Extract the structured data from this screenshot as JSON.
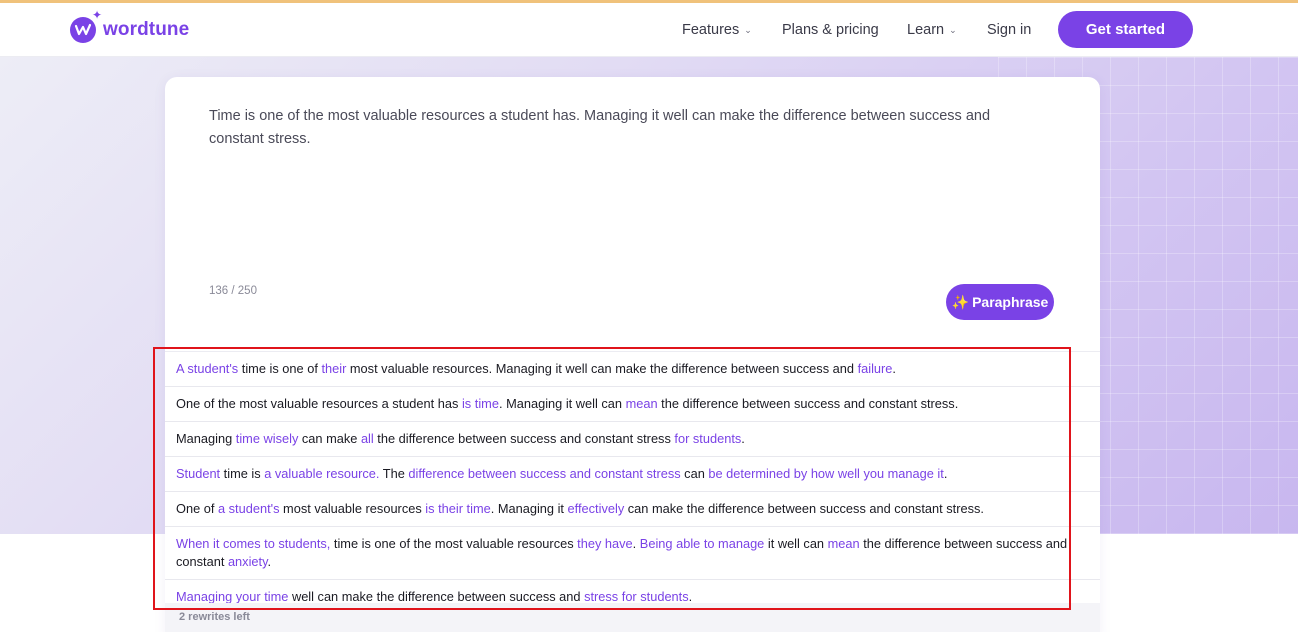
{
  "brand": {
    "name": "wordtune",
    "accent": "#7a42e6",
    "logo_icon": "wordtune-logo-icon"
  },
  "nav": {
    "features": "Features",
    "plans": "Plans & pricing",
    "learn": "Learn",
    "signin": "Sign in",
    "cta": "Get started"
  },
  "editor": {
    "input_text": "Time is one of the most valuable resources a student has. Managing it well can make the difference between success and constant stress.",
    "counter": "136 / 250",
    "paraphrase_label": "Paraphrase"
  },
  "rewrites": [
    [
      {
        "t": "A student's",
        "h": true
      },
      {
        "t": " time is one of "
      },
      {
        "t": "their",
        "h": true
      },
      {
        "t": " most valuable resources. Managing it well can make the difference between success and "
      },
      {
        "t": "failure",
        "h": true
      },
      {
        "t": "."
      }
    ],
    [
      {
        "t": "One of the most valuable resources a student has "
      },
      {
        "t": "is time",
        "h": true
      },
      {
        "t": ". Managing it well can "
      },
      {
        "t": "mean",
        "h": true
      },
      {
        "t": " the difference between success and constant stress."
      }
    ],
    [
      {
        "t": "Managing "
      },
      {
        "t": "time wisely",
        "h": true
      },
      {
        "t": " can make "
      },
      {
        "t": "all",
        "h": true
      },
      {
        "t": " the difference between success and constant stress "
      },
      {
        "t": "for students",
        "h": true
      },
      {
        "t": "."
      }
    ],
    [
      {
        "t": "Student",
        "h": true
      },
      {
        "t": " time is "
      },
      {
        "t": "a valuable resource.",
        "h": true
      },
      {
        "t": " The "
      },
      {
        "t": "difference between success and constant stress",
        "h": true
      },
      {
        "t": " can "
      },
      {
        "t": "be determined by how well you manage it",
        "h": true
      },
      {
        "t": "."
      }
    ],
    [
      {
        "t": "One of "
      },
      {
        "t": "a student's",
        "h": true
      },
      {
        "t": " most valuable resources "
      },
      {
        "t": "is their time",
        "h": true
      },
      {
        "t": ". Managing it "
      },
      {
        "t": "effectively",
        "h": true
      },
      {
        "t": " can make the difference between success and constant stress."
      }
    ],
    [
      {
        "t": "When it comes to students,",
        "h": true
      },
      {
        "t": " time is one of the most valuable resources "
      },
      {
        "t": "they have",
        "h": true
      },
      {
        "t": ". "
      },
      {
        "t": "Being able to manage",
        "h": true
      },
      {
        "t": " it well can "
      },
      {
        "t": "mean",
        "h": true
      },
      {
        "t": " the difference between success and constant "
      },
      {
        "t": "anxiety",
        "h": true
      },
      {
        "t": "."
      }
    ],
    [
      {
        "t": "Managing your time",
        "h": true
      },
      {
        "t": " well can make the difference between success and "
      },
      {
        "t": "stress for students",
        "h": true
      },
      {
        "t": "."
      }
    ]
  ],
  "rewrites_left": "2 rewrites left",
  "colors": {
    "highlight": "#7a42e6",
    "annotation_box": "#e0141b"
  }
}
